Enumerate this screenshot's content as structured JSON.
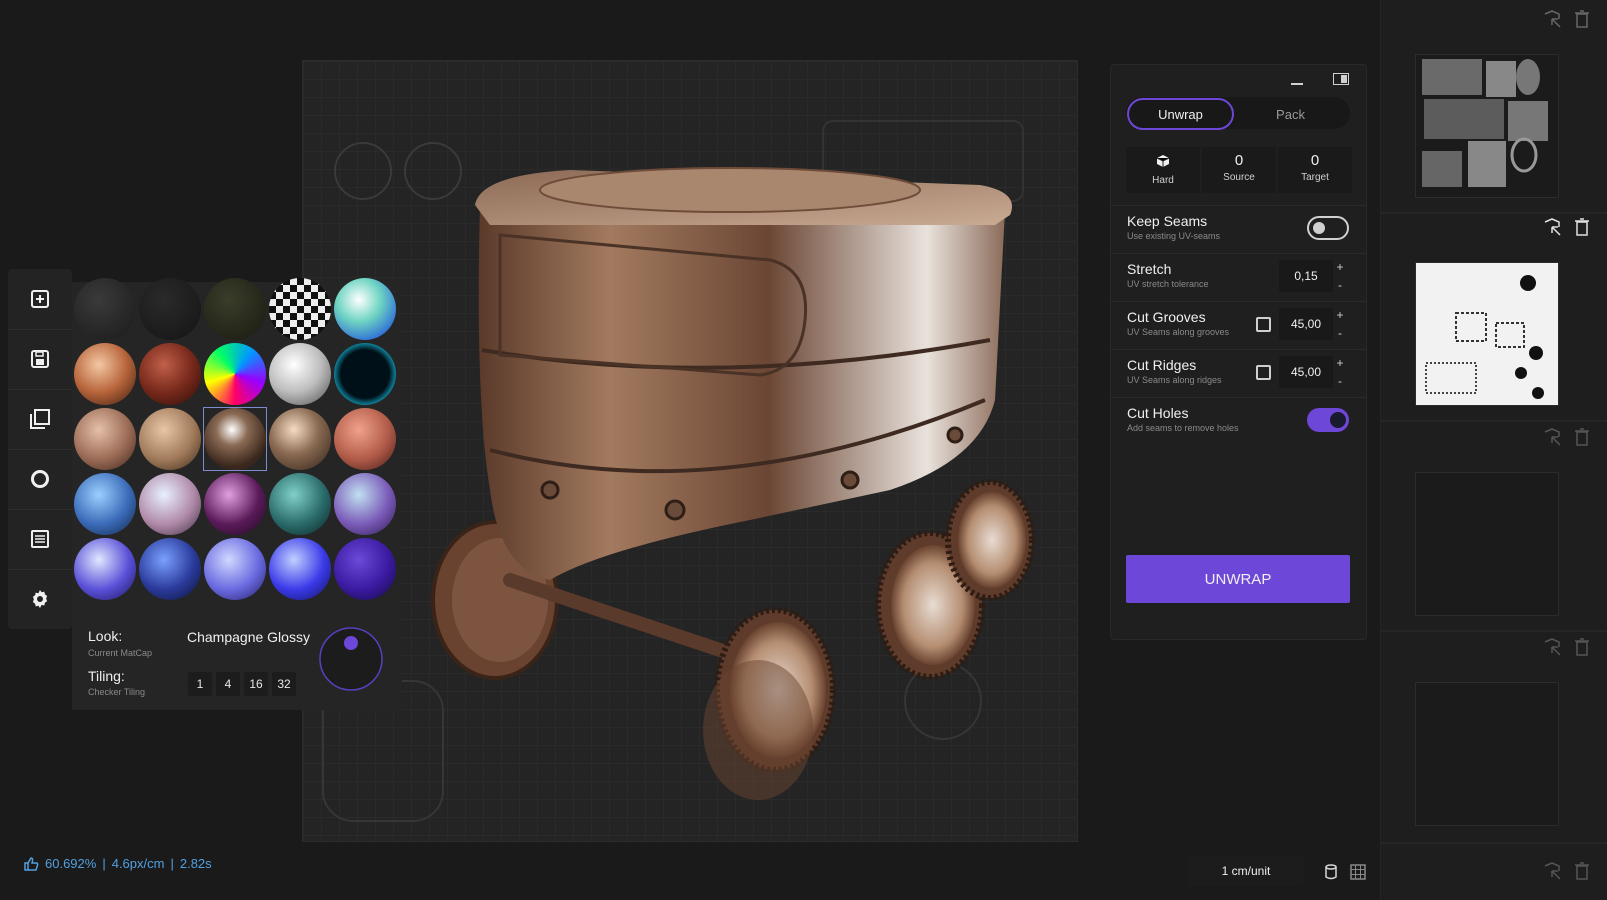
{
  "matcap": {
    "look_label": "Look:",
    "look_sub": "Current MatCap",
    "look_value": "Champagne Glossy",
    "tiling_label": "Tiling:",
    "tiling_sub": "Checker Tiling",
    "tiling_options": [
      "1",
      "4",
      "16",
      "32"
    ],
    "selected_index": 12
  },
  "unwrap_panel": {
    "tabs": [
      "Unwrap",
      "Pack"
    ],
    "active_tab": "Unwrap",
    "stats": [
      {
        "value": "",
        "label": "Hard",
        "icon": "cube-icon"
      },
      {
        "value": "0",
        "label": "Source"
      },
      {
        "value": "0",
        "label": "Target"
      }
    ],
    "keep_seams": {
      "title": "Keep Seams",
      "sub": "Use existing UV-seams",
      "on": false
    },
    "stretch": {
      "title": "Stretch",
      "sub": "UV stretch tolerance",
      "value": "0,15"
    },
    "cut_grooves": {
      "title": "Cut Grooves",
      "sub": "UV Seams along grooves",
      "value": "45,00",
      "checked": false
    },
    "cut_ridges": {
      "title": "Cut Ridges",
      "sub": "UV Seams along ridges",
      "value": "45,00",
      "checked": false
    },
    "cut_holes": {
      "title": "Cut Holes",
      "sub": "Add seams to remove holes",
      "on": true
    },
    "unwrap_button": "UNWRAP",
    "plus": "+",
    "minus": "-"
  },
  "status_bar": {
    "quality": "60.692%",
    "sep1": "|",
    "density": "4.6px/cm",
    "sep2": "|",
    "time": "2.82s"
  },
  "units": "1 cm/unit",
  "colors": {
    "accent": "#6c47d8",
    "status_text": "#53a0e0",
    "background": "#181818"
  },
  "icons": {
    "toolbar": [
      "add-icon",
      "save-icon",
      "layers-icon",
      "circle-icon",
      "list-icon",
      "gear-icon"
    ],
    "sidebar": [
      "select-icon",
      "trash-icon"
    ]
  }
}
